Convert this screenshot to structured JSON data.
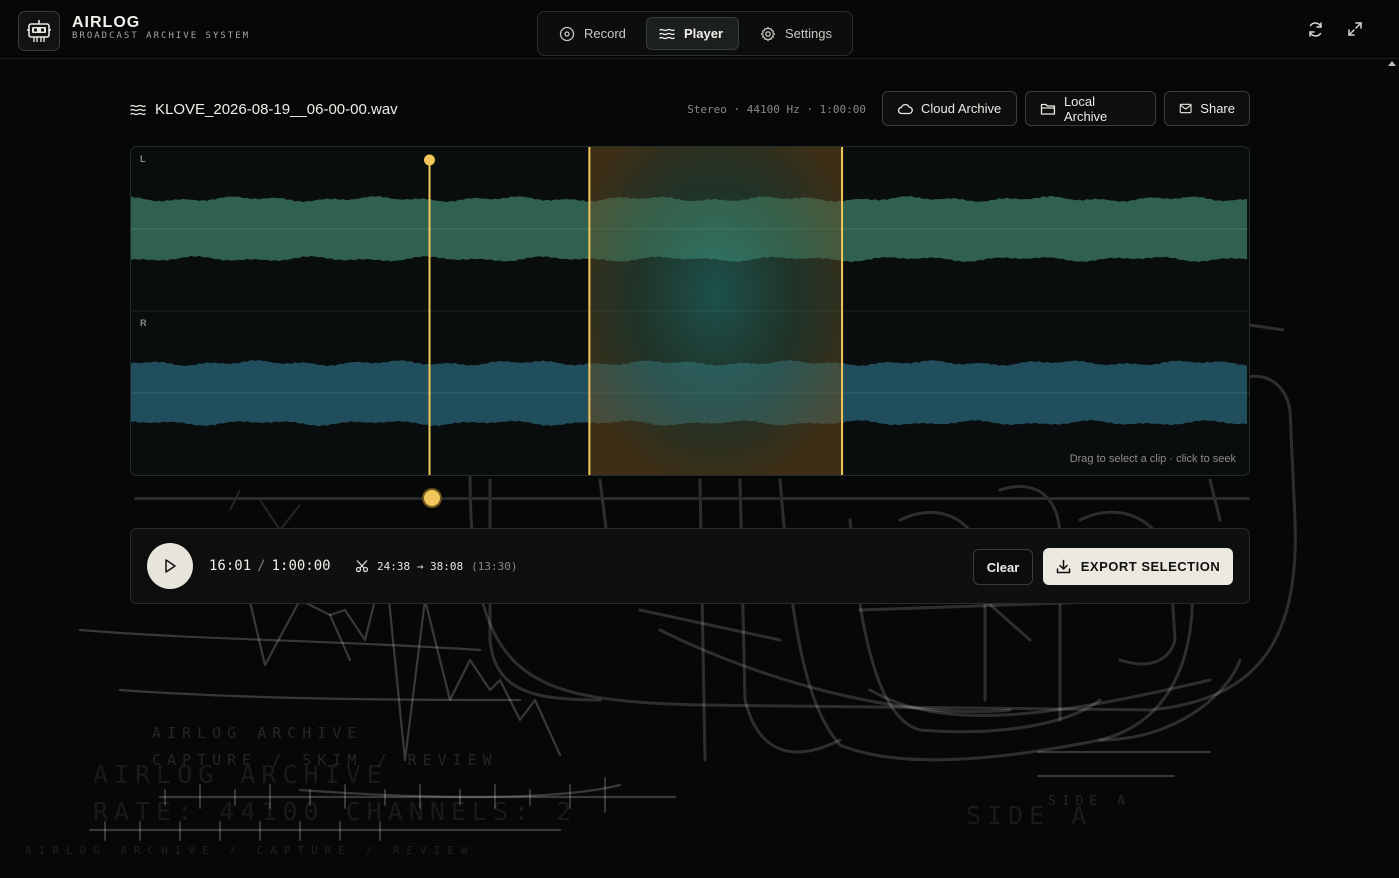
{
  "brand": {
    "title": "AIRLOG",
    "subtitle": "BROADCAST ARCHIVE SYSTEM"
  },
  "nav": {
    "tabs": [
      {
        "label": "Record",
        "icon": "disc-icon",
        "active": false
      },
      {
        "label": "Player",
        "icon": "waves-icon",
        "active": true
      },
      {
        "label": "Settings",
        "icon": "gear-icon",
        "active": false
      }
    ]
  },
  "toolbar": {
    "refresh_icon": "refresh-icon",
    "fullscreen_icon": "expand-icon"
  },
  "file": {
    "name": "KLOVE_2026-08-19__06-00-00.wav",
    "meta": "Stereo · 44100 Hz · 1:00:00"
  },
  "actions": {
    "cloud": "Cloud Archive",
    "local": "Local Archive",
    "share": "Share"
  },
  "waveform": {
    "left_label": "L",
    "right_label": "R",
    "hint": "Drag to select a clip · click to seek",
    "playhead_fraction": 0.267,
    "selection_start_fraction": 0.41,
    "selection_end_fraction": 0.636,
    "colors": {
      "left": "#3e7d66",
      "right": "#2a6478",
      "accent": "#f1c65a"
    }
  },
  "transport": {
    "current_time": "16:01",
    "separator": "/",
    "total_time": "1:00:00",
    "sel_start": "24:38",
    "sel_arrow": "→",
    "sel_end": "38:08",
    "sel_duration": "(13:30)",
    "clear": "Clear",
    "export": "EXPORT SELECTION"
  },
  "background": {
    "line1": "AIRLOG ARCHIVE",
    "line2": "CAPTURE / SKIM / REVIEW",
    "line3": "AIRLOG ARCHIVE",
    "line4": "RATE: 44100 CHANNELS: 2",
    "line5": "AIRLOG ARCHIVE / CAPTURE / REVIEW",
    "side1": "SIDE A",
    "side2": "SIDE A"
  }
}
